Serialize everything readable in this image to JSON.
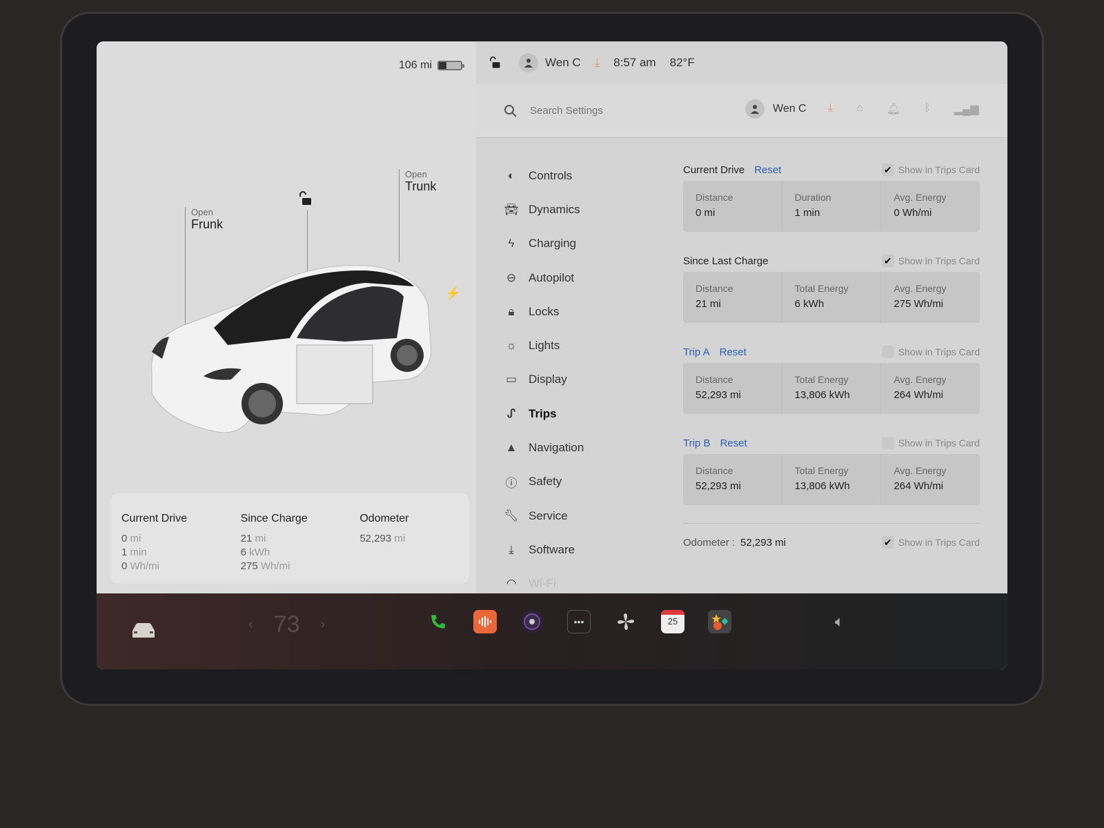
{
  "status": {
    "range": "106 mi",
    "battery_level_pct": 35,
    "user": "Wen C",
    "time": "8:57 am",
    "temperature": "82°F"
  },
  "car_view": {
    "frunk": {
      "action": "Open",
      "label": "Frunk"
    },
    "trunk": {
      "action": "Open",
      "label": "Trunk"
    }
  },
  "trips_card": {
    "current_drive": {
      "title": "Current Drive",
      "distance": "0",
      "distance_unit": "mi",
      "duration": "1",
      "duration_unit": "min",
      "energy": "0",
      "energy_unit": "Wh/mi"
    },
    "since_charge": {
      "title": "Since Charge",
      "distance": "21",
      "distance_unit": "mi",
      "energy_total": "6",
      "energy_total_unit": "kWh",
      "energy": "275",
      "energy_unit": "Wh/mi"
    },
    "odometer": {
      "title": "Odometer",
      "value": "52,293",
      "unit": "mi"
    }
  },
  "search": {
    "placeholder": "Search Settings",
    "user": "Wen C"
  },
  "nav": {
    "items": [
      {
        "label": "Controls",
        "icon": "toggle-icon"
      },
      {
        "label": "Dynamics",
        "icon": "car-icon"
      },
      {
        "label": "Charging",
        "icon": "bolt-icon"
      },
      {
        "label": "Autopilot",
        "icon": "steering-wheel-icon"
      },
      {
        "label": "Locks",
        "icon": "lock-icon"
      },
      {
        "label": "Lights",
        "icon": "sun-icon"
      },
      {
        "label": "Display",
        "icon": "display-icon"
      },
      {
        "label": "Trips",
        "icon": "trips-icon"
      },
      {
        "label": "Navigation",
        "icon": "navigation-arrow-icon"
      },
      {
        "label": "Safety",
        "icon": "alert-circle-icon"
      },
      {
        "label": "Service",
        "icon": "wrench-icon"
      },
      {
        "label": "Software",
        "icon": "download-icon"
      },
      {
        "label": "Wi-Fi",
        "icon": "wifi-icon"
      }
    ],
    "active": "Trips"
  },
  "trips": {
    "show_label": "Show in Trips Card",
    "reset_label": "Reset",
    "current_drive": {
      "title": "Current Drive",
      "show_checked": true,
      "stats": [
        {
          "label": "Distance",
          "value": "0 mi"
        },
        {
          "label": "Duration",
          "value": "1 min"
        },
        {
          "label": "Avg. Energy",
          "value": "0 Wh/mi"
        }
      ]
    },
    "since_last_charge": {
      "title": "Since Last Charge",
      "show_checked": true,
      "stats": [
        {
          "label": "Distance",
          "value": "21 mi"
        },
        {
          "label": "Total Energy",
          "value": "6 kWh"
        },
        {
          "label": "Avg. Energy",
          "value": "275 Wh/mi"
        }
      ]
    },
    "trip_a": {
      "title": "Trip A",
      "show_checked": false,
      "stats": [
        {
          "label": "Distance",
          "value": "52,293 mi"
        },
        {
          "label": "Total Energy",
          "value": "13,806 kWh"
        },
        {
          "label": "Avg. Energy",
          "value": "264 Wh/mi"
        }
      ]
    },
    "trip_b": {
      "title": "Trip B",
      "show_checked": false,
      "stats": [
        {
          "label": "Distance",
          "value": "52,293 mi"
        },
        {
          "label": "Total Energy",
          "value": "13,806 kWh"
        },
        {
          "label": "Avg. Energy",
          "value": "264 Wh/mi"
        }
      ]
    },
    "odometer": {
      "label": "Odometer :",
      "value": "52,293 mi",
      "show_checked": true
    }
  },
  "dock": {
    "cabin_temp": "73",
    "apps": [
      "phone-icon",
      "voice-recorder-icon",
      "camera-icon",
      "more-icon",
      "fan-icon",
      "calendar-icon",
      "toybox-icon"
    ],
    "calendar_day": "25"
  },
  "colors": {
    "accent_blue": "#2b5fb3",
    "phone_green": "#2dbb3a",
    "recorder_orange": "#e8683a",
    "download_orange": "#e8906a"
  }
}
